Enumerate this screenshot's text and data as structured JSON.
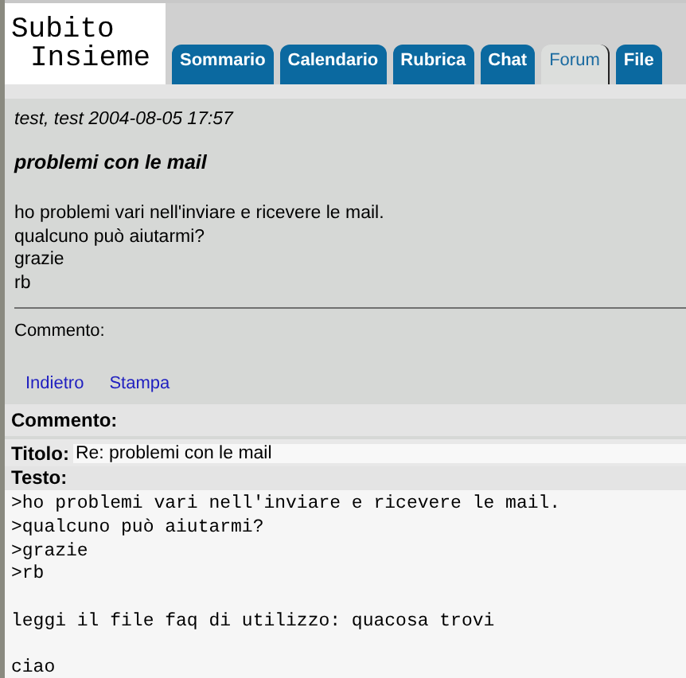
{
  "logo": {
    "line1": "Subito",
    "line2": "Insieme"
  },
  "tabs": [
    {
      "label": "Sommario",
      "selected": false
    },
    {
      "label": "Calendario",
      "selected": false
    },
    {
      "label": "Rubrica",
      "selected": false
    },
    {
      "label": "Chat",
      "selected": false
    },
    {
      "label": "Forum",
      "selected": true
    },
    {
      "label": "File",
      "selected": false
    }
  ],
  "post": {
    "meta": "test, test 2004-08-05 17:57",
    "title": "problemi con le mail",
    "body": [
      "ho problemi vari nell'inviare e ricevere le mail.",
      "qualcuno può aiutarmi?",
      "grazie",
      "rb"
    ],
    "comment_label": "Commento:"
  },
  "links": [
    "Indietro",
    "Stampa"
  ],
  "form": {
    "heading": "Commento:",
    "title_label": "Titolo:",
    "title_value": "Re: problemi con le mail",
    "text_label": "Testo:",
    "text_value": ">ho problemi vari nell'inviare e ricevere le mail.\n>qualcuno può aiutarmi?\n>grazie\n>rb\n\nleggi il file faq di utilizzo: quacosa trovi\n\nciao"
  }
}
